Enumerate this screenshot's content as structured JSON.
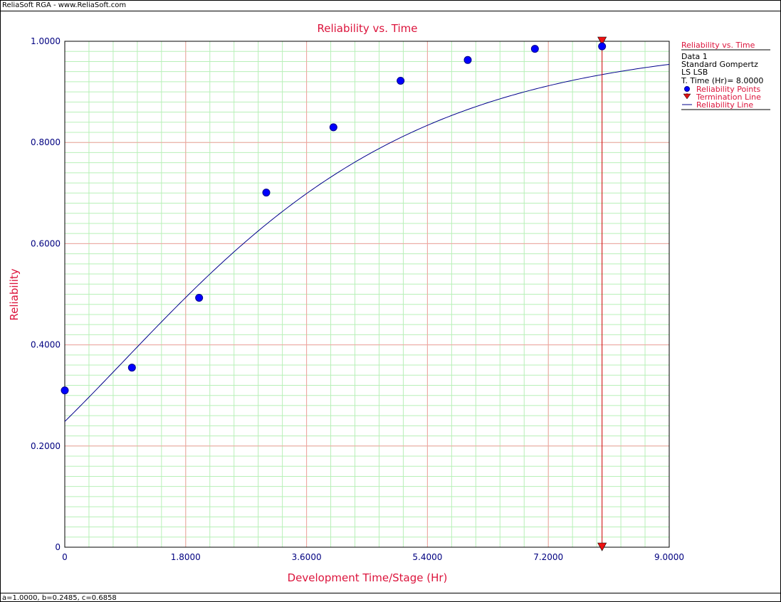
{
  "window": {
    "caption": "ReliaSoft RGA - www.ReliaSoft.com",
    "footer": "a=1.0000, b=0.2485, c=0.6858"
  },
  "colors": {
    "title": "#dc143c",
    "axis_text": "#000080",
    "major_grid": "#f4a0a0",
    "minor_grid": "#b8f0b8",
    "points": "#0000ff",
    "line": "#00008b",
    "termination": "#cc0000"
  },
  "chart_data": {
    "type": "scatter",
    "title": "Reliability vs. Time",
    "xlabel": "Development Time/Stage (Hr)",
    "ylabel": "Reliability",
    "xlim": [
      0,
      9
    ],
    "ylim": [
      0,
      1
    ],
    "x_ticks": [
      "0",
      "1.8000",
      "3.6000",
      "5.4000",
      "7.2000",
      "9.0000"
    ],
    "x_tick_values": [
      0,
      1.8,
      3.6,
      5.4,
      7.2,
      9.0
    ],
    "y_ticks": [
      "0",
      "0.2000",
      "0.4000",
      "0.6000",
      "0.8000",
      "1.0000"
    ],
    "y_tick_values": [
      0,
      0.2,
      0.4,
      0.6,
      0.8,
      1.0
    ],
    "grid": true,
    "series": [
      {
        "name": "Reliability Points",
        "kind": "scatter",
        "x": [
          0,
          1,
          2,
          3,
          4,
          5,
          6,
          7,
          8
        ],
        "y": [
          0.31,
          0.355,
          0.493,
          0.701,
          0.83,
          0.922,
          0.963,
          0.985,
          0.99
        ]
      },
      {
        "name": "Reliability Line",
        "kind": "line",
        "model": "gompertz",
        "params": {
          "a": 1.0,
          "b": 0.2485,
          "c": 0.6858
        }
      },
      {
        "name": "Termination Line",
        "kind": "vertical",
        "x": 8
      }
    ],
    "legend": {
      "placement": "right",
      "title": "Reliability vs. Time",
      "lines": [
        "Data 1",
        "Standard Gompertz",
        "LS LSB",
        "T. Time (Hr)= 8.0000"
      ],
      "items": [
        "Reliability Points",
        "Termination Line",
        "Reliability Line"
      ]
    }
  }
}
